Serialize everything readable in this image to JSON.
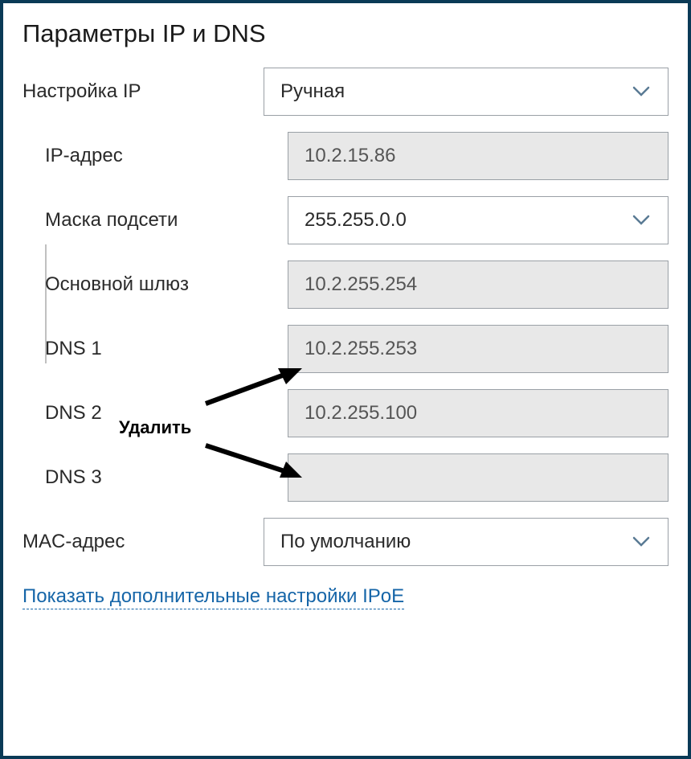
{
  "section_title": "Параметры IP и DNS",
  "ip_mode": {
    "label": "Настройка IP",
    "value": "Ручная"
  },
  "fields": {
    "ip_address": {
      "label": "IP-адрес",
      "value": "10.2.15.86"
    },
    "subnet_mask": {
      "label": "Маска подсети",
      "value": "255.255.0.0"
    },
    "gateway": {
      "label": "Основной шлюз",
      "value": "10.2.255.254"
    },
    "dns1": {
      "label": "DNS 1",
      "value": "10.2.255.253"
    },
    "dns2": {
      "label": "DNS 2",
      "value": "10.2.255.100"
    },
    "dns3": {
      "label": "DNS 3",
      "value": ""
    }
  },
  "mac": {
    "label": "MAC-адрес",
    "value": "По умолчанию"
  },
  "show_more_link": "Показать дополнительные настройки IPoE",
  "annotation": {
    "text": "Удалить"
  },
  "colors": {
    "border_frame": "#0a3a56",
    "link": "#1565a8",
    "field_border": "#9aa0a6",
    "disabled_bg": "#e8e8e8"
  }
}
